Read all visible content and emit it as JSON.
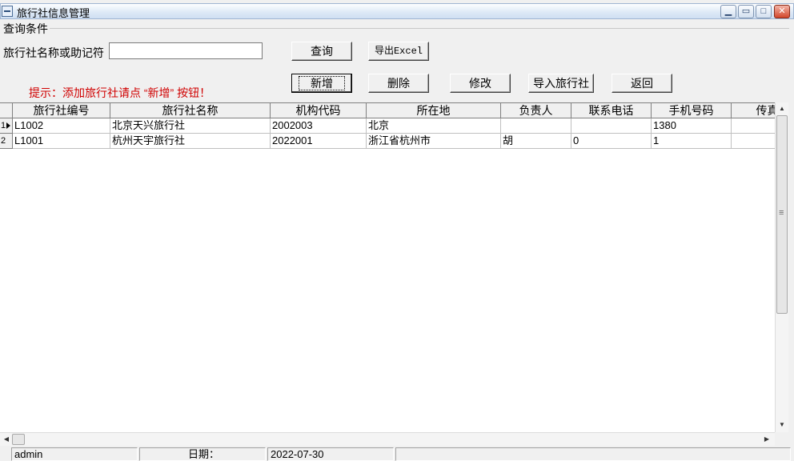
{
  "window": {
    "title": "旅行社信息管理",
    "controls": {
      "minimize": "▁",
      "restore": "▭",
      "maximize": "□",
      "close": "✕"
    }
  },
  "query": {
    "group_title": "查询条件",
    "name_label": "旅行社名称或助记符",
    "name_value": "",
    "query_button": "查询",
    "export_button": "导出Excel"
  },
  "hint": "提示：添加旅行社请点 “新增” 按钮！",
  "actions": {
    "add": "新增",
    "delete": "删除",
    "modify": "修改",
    "import": "导入旅行社",
    "back": "返回"
  },
  "grid": {
    "columns": [
      "旅行社编号",
      "旅行社名称",
      "机构代码",
      "所在地",
      "负责人",
      "联系电话",
      "手机号码",
      "传真"
    ],
    "rows": [
      {
        "index": "1",
        "cells": [
          "L1002",
          "北京天兴旅行社",
          "2002003",
          "北京",
          "",
          "",
          "1380",
          ""
        ]
      },
      {
        "index": "2",
        "cells": [
          "L1001",
          "杭州天宇旅行社",
          "2022001",
          "浙江省杭州市",
          "胡",
          "0",
          "1",
          ""
        ]
      }
    ]
  },
  "scrollbars": {
    "up": "▲",
    "down": "▼",
    "left": "◀",
    "right": "▶"
  },
  "status": {
    "user": "admin",
    "date_label": "日期：",
    "date_value": "2022-07-30"
  }
}
